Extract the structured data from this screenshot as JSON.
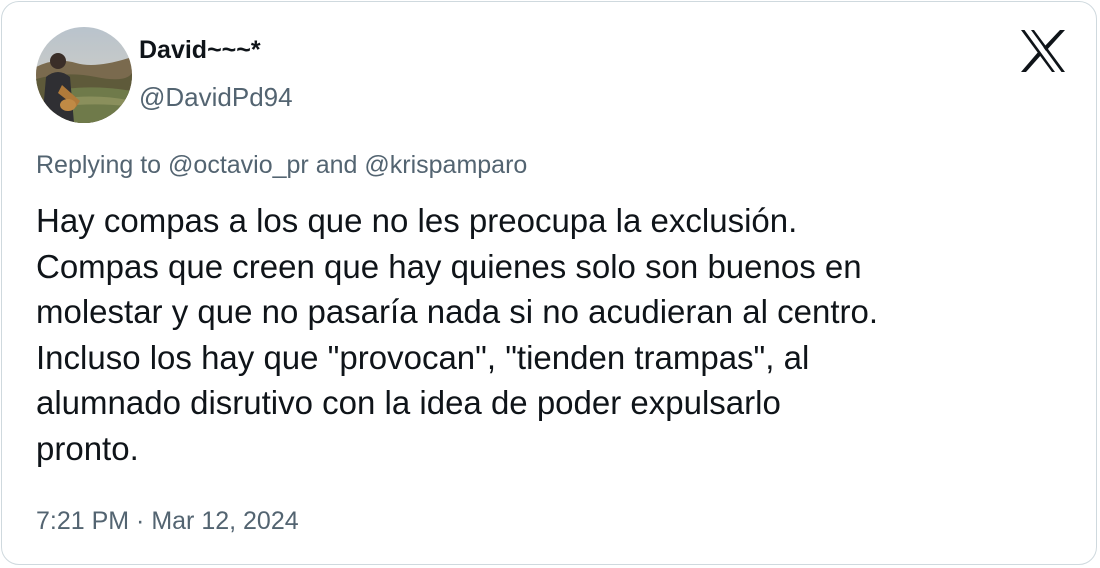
{
  "author": {
    "display_name": "David~~~*",
    "handle": "@DavidPd94",
    "avatar_icon": "person-landscape-avatar"
  },
  "brand": {
    "logo_icon": "x-logo-icon",
    "color": "#0f1419"
  },
  "reply": {
    "prefix": "Replying to ",
    "mentions": [
      "@octavio_pr",
      "@krispamparo"
    ],
    "joiner": " and "
  },
  "tweet": {
    "text": "Hay compas a los que no les preocupa la exclusión.\nCompas que creen que hay quienes solo son buenos en\nmolestar y que no pasaría nada si no acudieran al centro.\nIncluso los hay que \"provocan\", \"tienden trampas\", al\nalumnado disrutivo con la idea de poder expulsarlo\npronto.",
    "timestamp": "7:21 PM · Mar 12, 2024"
  },
  "colors": {
    "text_primary": "#0f1419",
    "text_secondary": "#536471",
    "border": "#cfd9de"
  }
}
